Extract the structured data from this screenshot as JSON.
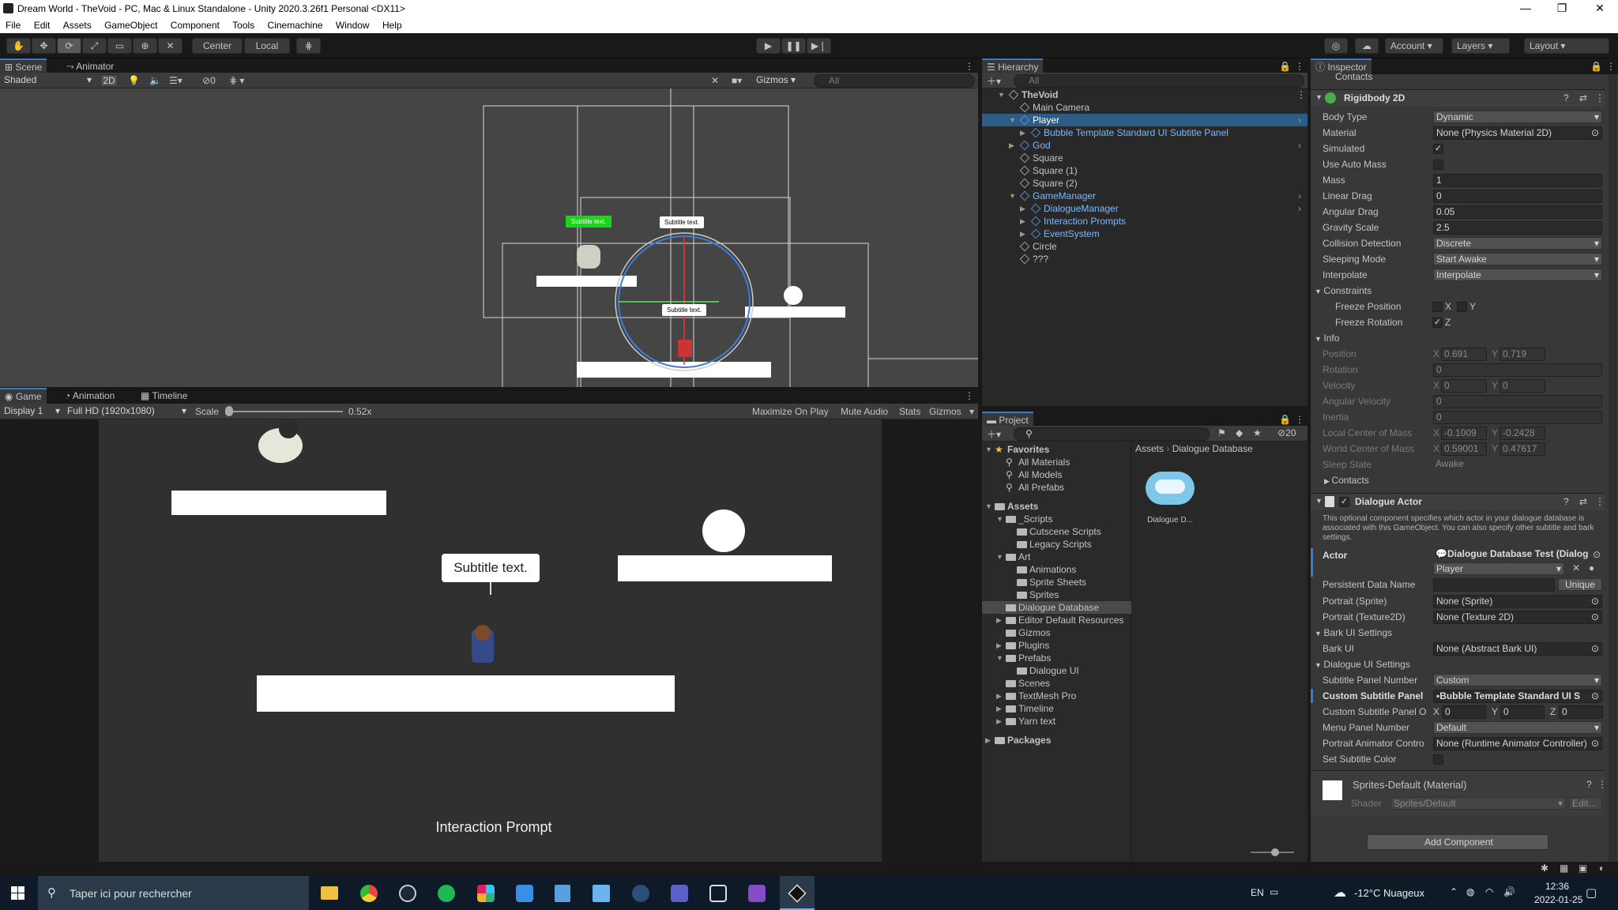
{
  "window": {
    "title": "Dream World - TheVoid - PC, Mac & Linux Standalone - Unity 2020.3.26f1 Personal <DX11>",
    "controls": [
      "—",
      "❐",
      "✕"
    ]
  },
  "menu": [
    "File",
    "Edit",
    "Assets",
    "GameObject",
    "Component",
    "Tools",
    "Cinemachine",
    "Window",
    "Help"
  ],
  "toolbar": {
    "pivot": "Center",
    "space": "Local",
    "account": "Account",
    "layers": "Layers",
    "layout": "Layout"
  },
  "scene": {
    "tabs": [
      "Scene",
      "Animator"
    ],
    "shading": "Shaded",
    "mode2d": "2D",
    "hidden_count": "0",
    "gizmos": "Gizmos",
    "search_placeholder": "All",
    "labels": [
      "Subtitle text.",
      "Subtitle text.",
      "Subtitle text."
    ]
  },
  "game": {
    "tabs": [
      "Game",
      "Animation",
      "Timeline"
    ],
    "display": "Display 1",
    "resolution": "Full HD (1920x1080)",
    "scale_label": "Scale",
    "scale_value": "0.52x",
    "scale_level": 0.0,
    "buttons": [
      "Maximize On Play",
      "Mute Audio",
      "Stats",
      "Gizmos"
    ],
    "bubble_text": "Subtitle text.",
    "prompt_text": "Interaction Prompt"
  },
  "hierarchy": {
    "tab": "Hierarchy",
    "search_placeholder": "All",
    "items": [
      {
        "label": "TheVoid",
        "depth": 0,
        "expanded": true,
        "icon": "unity-scene-icon"
      },
      {
        "label": "Main Camera",
        "depth": 1,
        "icon": "gameobject-icon"
      },
      {
        "label": "Player",
        "depth": 1,
        "expanded": true,
        "selected": true,
        "prefab": true,
        "icon": "prefab-icon"
      },
      {
        "label": "Bubble Template Standard UI Subtitle Panel",
        "depth": 2,
        "prefab": true,
        "icon": "prefab-icon"
      },
      {
        "label": "God",
        "depth": 1,
        "prefab": true,
        "icon": "prefab-icon"
      },
      {
        "label": "Square",
        "depth": 1,
        "icon": "gameobject-icon"
      },
      {
        "label": "Square (1)",
        "depth": 1,
        "icon": "gameobject-icon"
      },
      {
        "label": "Square (2)",
        "depth": 1,
        "icon": "gameobject-icon"
      },
      {
        "label": "GameManager",
        "depth": 1,
        "expanded": true,
        "prefab": true,
        "icon": "prefab-icon"
      },
      {
        "label": "DialogueManager",
        "depth": 2,
        "prefab": true,
        "icon": "prefab-icon"
      },
      {
        "label": "Interaction Prompts",
        "depth": 2,
        "prefab": true,
        "icon": "prefab-icon"
      },
      {
        "label": "EventSystem",
        "depth": 2,
        "prefab": true,
        "icon": "prefab-icon"
      },
      {
        "label": "Circle",
        "depth": 1,
        "icon": "gameobject-icon"
      },
      {
        "label": "???",
        "depth": 1,
        "icon": "gameobject-icon"
      }
    ]
  },
  "project": {
    "tab": "Project",
    "hidden_count": "20",
    "breadcrumb": [
      "Assets",
      "Dialogue Database"
    ],
    "asset_label": "Dialogue D...",
    "tree": [
      {
        "label": "Favorites",
        "depth": 0,
        "kind": "star"
      },
      {
        "label": "All Materials",
        "depth": 1,
        "kind": "search"
      },
      {
        "label": "All Models",
        "depth": 1,
        "kind": "search"
      },
      {
        "label": "All Prefabs",
        "depth": 1,
        "kind": "search"
      },
      {
        "label": "Assets",
        "depth": 0,
        "kind": "folder"
      },
      {
        "label": "_Scripts",
        "depth": 1,
        "kind": "folder"
      },
      {
        "label": "Cutscene Scripts",
        "depth": 2,
        "kind": "folder"
      },
      {
        "label": "Legacy Scripts",
        "depth": 2,
        "kind": "folder"
      },
      {
        "label": "Art",
        "depth": 1,
        "kind": "folder"
      },
      {
        "label": "Animations",
        "depth": 2,
        "kind": "folder"
      },
      {
        "label": "Sprite Sheets",
        "depth": 2,
        "kind": "folder"
      },
      {
        "label": "Sprites",
        "depth": 2,
        "kind": "folder"
      },
      {
        "label": "Dialogue Database",
        "depth": 1,
        "kind": "folder",
        "selected": true
      },
      {
        "label": "Editor Default Resources",
        "depth": 1,
        "kind": "folder"
      },
      {
        "label": "Gizmos",
        "depth": 1,
        "kind": "folder"
      },
      {
        "label": "Plugins",
        "depth": 1,
        "kind": "folder"
      },
      {
        "label": "Prefabs",
        "depth": 1,
        "kind": "folder"
      },
      {
        "label": "Dialogue UI",
        "depth": 2,
        "kind": "folder"
      },
      {
        "label": "Scenes",
        "depth": 1,
        "kind": "folder"
      },
      {
        "label": "TextMesh Pro",
        "depth": 1,
        "kind": "folder"
      },
      {
        "label": "Timeline",
        "depth": 1,
        "kind": "folder"
      },
      {
        "label": "Yarn text",
        "depth": 1,
        "kind": "folder"
      },
      {
        "label": "Packages",
        "depth": 0,
        "kind": "folder"
      }
    ]
  },
  "inspector": {
    "tab": "Inspector",
    "top_contacts": "Contacts",
    "rigidbody": {
      "title": "Rigidbody 2D",
      "rows": [
        {
          "label": "Body Type",
          "value": "Dynamic",
          "kind": "dropdown"
        },
        {
          "label": "Material",
          "value": "None (Physics Material 2D)",
          "kind": "object"
        },
        {
          "label": "Simulated",
          "value": "✓",
          "kind": "check"
        },
        {
          "label": "Use Auto Mass",
          "value": "",
          "kind": "check"
        },
        {
          "label": "Mass",
          "value": "1",
          "kind": "field"
        },
        {
          "label": "Linear Drag",
          "value": "0",
          "kind": "field"
        },
        {
          "label": "Angular Drag",
          "value": "0.05",
          "kind": "field"
        },
        {
          "label": "Gravity Scale",
          "value": "2.5",
          "kind": "field"
        },
        {
          "label": "Collision Detection",
          "value": "Discrete",
          "kind": "dropdown"
        },
        {
          "label": "Sleeping Mode",
          "value": "Start Awake",
          "kind": "dropdown"
        },
        {
          "label": "Interpolate",
          "value": "Interpolate",
          "kind": "dropdown"
        }
      ],
      "constraints": "Constraints",
      "freeze_position": "Freeze Position",
      "freeze_rotation": "Freeze Rotation",
      "axis_x": "X",
      "axis_y": "Y",
      "axis_z": "Z",
      "info": "Info",
      "info_rows": [
        {
          "label": "Position",
          "x": "0.691",
          "y": "0.719"
        },
        {
          "label": "Rotation",
          "value": "0"
        },
        {
          "label": "Velocity",
          "x": "0",
          "y": "0"
        },
        {
          "label": "Angular Velocity",
          "value": "0"
        },
        {
          "label": "Inertia",
          "value": "0"
        },
        {
          "label": "Local Center of Mass",
          "x": "-0.1009",
          "y": "-0.2428"
        },
        {
          "label": "World Center of Mass",
          "x": "0.59001",
          "y": "0.47617"
        },
        {
          "label": "Sleep State",
          "value": "Awake"
        }
      ],
      "contacts": "Contacts"
    },
    "dialogue_actor": {
      "title": "Dialogue Actor",
      "help": "This optional component specifies which actor in your dialogue database is associated with this GameObject. You can also specify other subtitle and bark settings.",
      "actor_label": "Actor",
      "actor_db": "Dialogue Database Test (Dialog",
      "actor_value": "Player",
      "persistent_label": "Persistent Data Name",
      "unique": "Unique",
      "portrait_sprite": {
        "label": "Portrait (Sprite)",
        "value": "None (Sprite)"
      },
      "portrait_tex": {
        "label": "Portrait (Texture2D)",
        "value": "None (Texture 2D)"
      },
      "bark_settings": "Bark UI Settings",
      "bark_ui": {
        "label": "Bark UI",
        "value": "None (Abstract Bark UI)"
      },
      "dialogue_settings": "Dialogue UI Settings",
      "subtitle_panel_number": {
        "label": "Subtitle Panel Number",
        "value": "Custom"
      },
      "custom_subtitle_panel": {
        "label": "Custom Subtitle Panel",
        "value": "Bubble Template Standard UI S"
      },
      "custom_offset": {
        "label": "Custom Subtitle Panel O",
        "x": "0",
        "y": "0",
        "z": "0"
      },
      "menu_panel_number": {
        "label": "Menu Panel Number",
        "value": "Default"
      },
      "portrait_animator": {
        "label": "Portrait Animator Contro",
        "value": "None (Runtime Animator Controller)"
      },
      "set_subtitle_color": "Set Subtitle Color"
    },
    "material": {
      "title": "Sprites-Default (Material)",
      "shader_label": "Shader",
      "shader_value": "Sprites/Default",
      "edit": "Edit..."
    },
    "add_component": "Add Component"
  },
  "taskbar": {
    "search_placeholder": "Taper ici pour rechercher",
    "lang": "EN",
    "weather": "-12°C  Nuageux",
    "time": "12:36",
    "date": "2022-01-25"
  }
}
